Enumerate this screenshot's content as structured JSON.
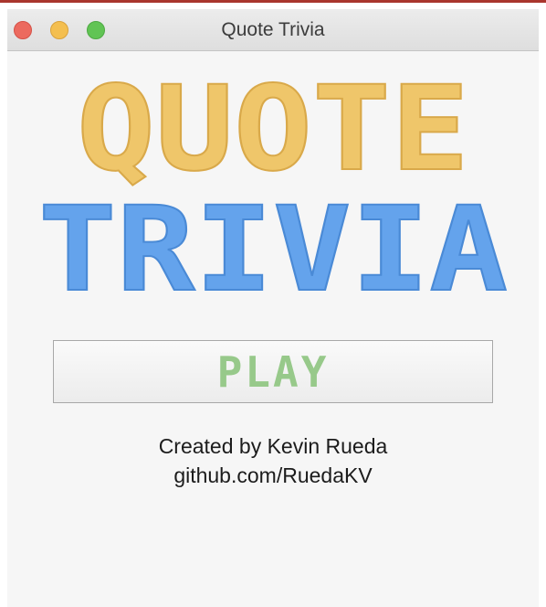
{
  "window": {
    "title": "Quote Trivia",
    "controls": [
      "close",
      "minimize",
      "zoom"
    ]
  },
  "logo": {
    "line1": "QUOTE",
    "line2": "TRIVIA",
    "line1_color": "#efc66a",
    "line2_color": "#64a3ec"
  },
  "play_button": {
    "label": "PLAY",
    "color": "#97c98a"
  },
  "credits": {
    "author": "Created by Kevin Rueda",
    "github": "github.com/RuedaKV"
  }
}
